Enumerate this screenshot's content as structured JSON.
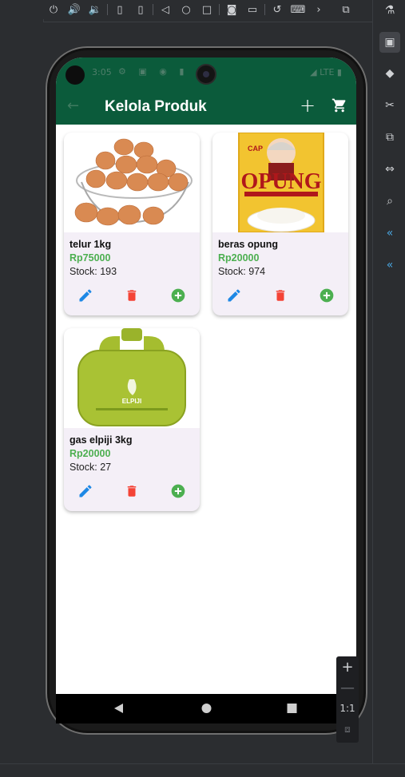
{
  "app": {
    "title": "Kelola Produk",
    "status_time": "3:05",
    "status_network": "LTE",
    "colors": {
      "primary": "#0b5b3b",
      "price": "#4caf50",
      "edit": "#1e88e5",
      "delete": "#f44336",
      "add": "#4caf50",
      "card": "#f4eff7"
    }
  },
  "products": [
    {
      "name": "telur 1kg",
      "price": "Rp75000",
      "stock": "Stock: 193",
      "image": "eggs-basket"
    },
    {
      "name": "beras opung",
      "price": "Rp20000",
      "stock": "Stock: 974",
      "image": "rice-bag"
    },
    {
      "name": "gas elpiji 3kg",
      "price": "Rp20000",
      "stock": "Stock: 27",
      "image": "lpg-cylinder"
    }
  ],
  "rice_bag": {
    "brand_small": "CAP",
    "brand": "OPUNG"
  },
  "lpg": {
    "brand": "ELPIJI"
  },
  "emulator": {
    "zoom_label": "1:1"
  }
}
